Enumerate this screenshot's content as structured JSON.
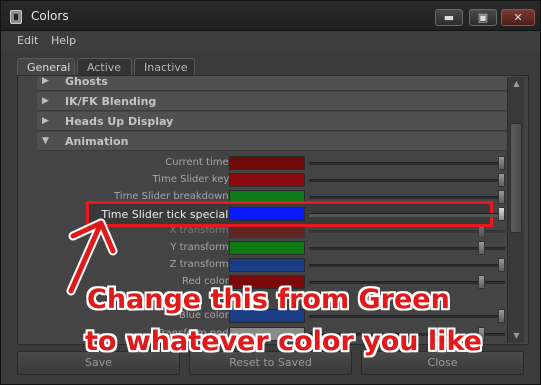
{
  "window": {
    "title": "Colors",
    "buttons": {
      "minimize": "▬",
      "maximize": "▣",
      "close": "✕"
    }
  },
  "menu": {
    "items": [
      "Edit",
      "Help"
    ]
  },
  "tabs": [
    {
      "label": "General",
      "active": true
    },
    {
      "label": "Active",
      "active": false
    },
    {
      "label": "Inactive",
      "active": false
    }
  ],
  "sections": [
    {
      "label": "Ghosts",
      "expanded": false
    },
    {
      "label": "IK/FK Blending",
      "expanded": false
    },
    {
      "label": "Heads Up Display",
      "expanded": false
    },
    {
      "label": "Animation",
      "expanded": true
    }
  ],
  "rows": [
    {
      "label": "Current time:",
      "color": "#6e0a0a",
      "value": 1.0
    },
    {
      "label": "Time Slider key:",
      "color": "#8b0a10",
      "value": 1.0
    },
    {
      "label": "Time Slider breakdown:",
      "color": "#0d7a1a",
      "value": 1.0
    },
    {
      "label": "Time Slider tick special:",
      "color": "#0a1aff",
      "value": 1.0
    },
    {
      "label": "X transform:",
      "color": "#7a0a0a",
      "value": 0.9
    },
    {
      "label": "Y transform:",
      "color": "#0f7a14",
      "value": 0.9
    },
    {
      "label": "Z transform:",
      "color": "#1a3d86",
      "value": 1.0
    },
    {
      "label": "Red color:",
      "color": "#7a0a0a",
      "value": 0.9
    },
    {
      "label": "Blue color:",
      "color": "#1a3d86",
      "value": 1.0
    },
    {
      "label": "Transform pod:",
      "color": "#8a8a8a",
      "value": 0.9
    }
  ],
  "bottom_buttons": [
    "Save",
    "Reset to Saved",
    "Close"
  ],
  "annotation": {
    "line1": "Change this from Green",
    "line2": "to whatever color you like",
    "color": "#e01a1a"
  }
}
